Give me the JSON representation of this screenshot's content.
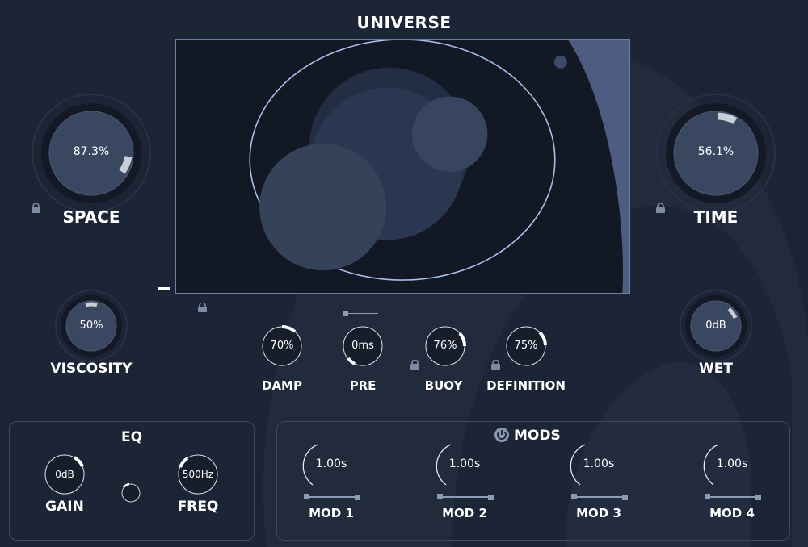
{
  "title": "UNIVERSE",
  "main_knobs": {
    "space": {
      "label": "SPACE",
      "value": "87.3%",
      "level": 0.873
    },
    "time": {
      "label": "TIME",
      "value": "56.1%",
      "level": 0.561
    },
    "viscosity": {
      "label": "VISCOSITY",
      "value": "50%",
      "level": 0.5
    },
    "wet": {
      "label": "WET",
      "value": "0dB",
      "level": 0.75
    }
  },
  "small_knobs": [
    {
      "label": "DAMP",
      "value": "70%",
      "level": 0.7
    },
    {
      "label": "PRE",
      "value": "0ms",
      "level": 0.0
    },
    {
      "label": "BUOY",
      "value": "76%",
      "level": 0.76
    },
    {
      "label": "DEFINITION",
      "value": "75%",
      "level": 0.75
    }
  ],
  "eq": {
    "title": "EQ",
    "gain": {
      "label": "GAIN",
      "value": "0dB",
      "level": 0.5
    },
    "freq": {
      "label": "FREQ",
      "value": "500Hz",
      "level": 0.5
    }
  },
  "mods": {
    "title": "MODS",
    "items": [
      {
        "label": "MOD 1",
        "value": "1.00s"
      },
      {
        "label": "MOD 2",
        "value": "1.00s"
      },
      {
        "label": "MOD 3",
        "value": "1.00s"
      },
      {
        "label": "MOD 4",
        "value": "1.00s"
      }
    ]
  },
  "colors": {
    "background": "#1c2535",
    "accent": "#ffffff",
    "ellipse": "#a9c0ee",
    "panel_border": "#3d4a61"
  }
}
